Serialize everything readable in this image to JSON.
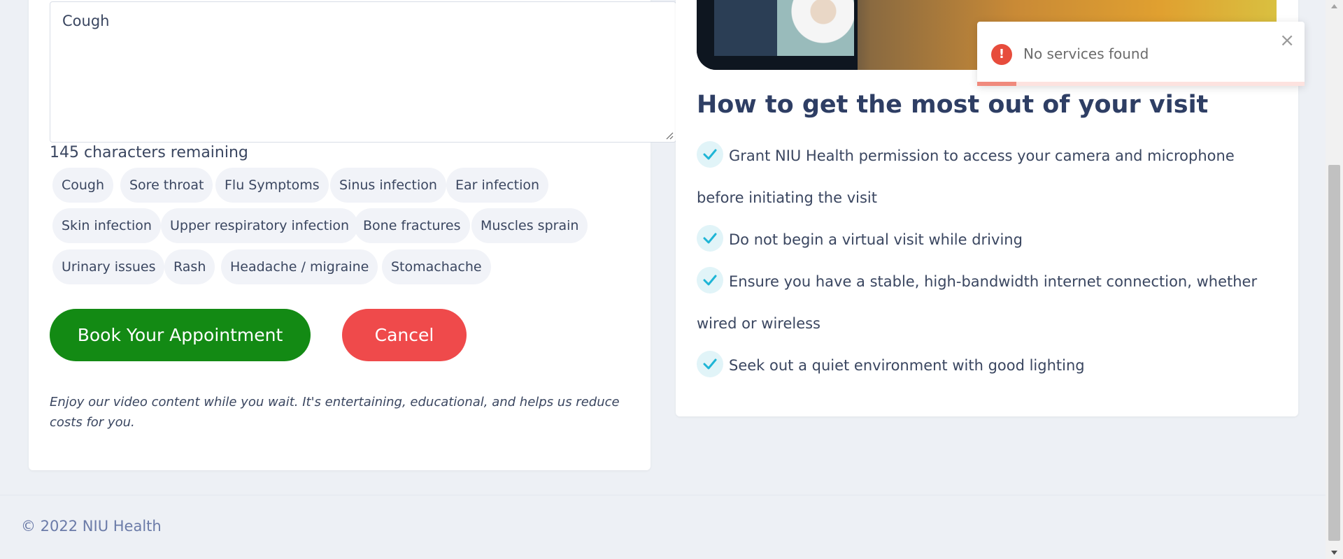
{
  "form": {
    "symptom_text": "Cough",
    "chars_remaining": "145 characters remaining",
    "chips": [
      "Cough",
      "Sore throat",
      "Flu Symptoms",
      "Sinus infection",
      "Ear infection",
      "Skin infection",
      "Upper respiratory infection",
      "Bone fractures",
      "Muscles sprain",
      "Urinary issues",
      "Rash",
      "Headache / migraine",
      "Stomachache"
    ],
    "book_label": "Book Your Appointment",
    "cancel_label": "Cancel",
    "note": "Enjoy our video content while you wait. It's entertaining, educational, and helps us reduce costs for you."
  },
  "tips": {
    "heading": "How to get the most out of your visit",
    "items": [
      "Grant NIU Health permission to access your camera and microphone before initiating the visit",
      "Do not begin a virtual visit while driving",
      "Ensure you have a stable, high-bandwidth internet connection, whether wired or wireless",
      "Seek out a quiet environment with good lighting"
    ]
  },
  "toast": {
    "icon": "!",
    "message": "No services found",
    "close": "×",
    "progress": 0.12
  },
  "footer": {
    "copyright": "© 2022 NIU Health"
  },
  "colors": {
    "book": "#138a14",
    "cancel": "#ef4a4b",
    "heading": "#2e3e64",
    "check": "#1eb5d6",
    "toast_error": "#e74c3c"
  }
}
